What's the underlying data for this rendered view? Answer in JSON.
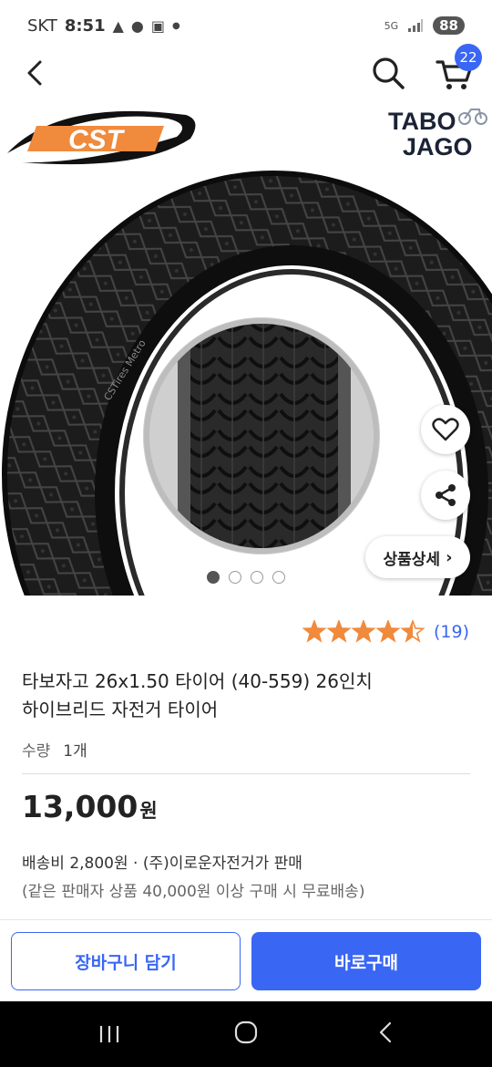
{
  "status_bar": {
    "carrier": "SKT",
    "time": "8:51",
    "network": "5G",
    "battery": "88"
  },
  "topbar": {
    "cart_count": "22"
  },
  "hero": {
    "brand_logo": "CST",
    "store_logo_line1": "TABO",
    "store_logo_line2": "JAGO",
    "detail_button": "상품상세",
    "image_count": 4,
    "active_image": 1
  },
  "product": {
    "rating": 4.5,
    "rating_count": "(19)",
    "title_line1": "타보자고 26x1.50 타이어 (40-559) 26인치",
    "title_line2": "하이브리드 자전거 타이어",
    "qty_label": "수량",
    "qty_value": "1개",
    "price": "13,000",
    "price_unit": "원",
    "shipping": "배송비 2,800원 · (주)이로운자전거가 판매",
    "shipping_note": "(같은 판매자 상품 40,000원 이상 구매 시 무료배송)"
  },
  "actions": {
    "add_to_cart": "장바구니 담기",
    "buy_now": "바로구매"
  },
  "colors": {
    "accent": "#3a66f4",
    "star": "#f08a3c",
    "logo_orange": "#f08a3c"
  }
}
